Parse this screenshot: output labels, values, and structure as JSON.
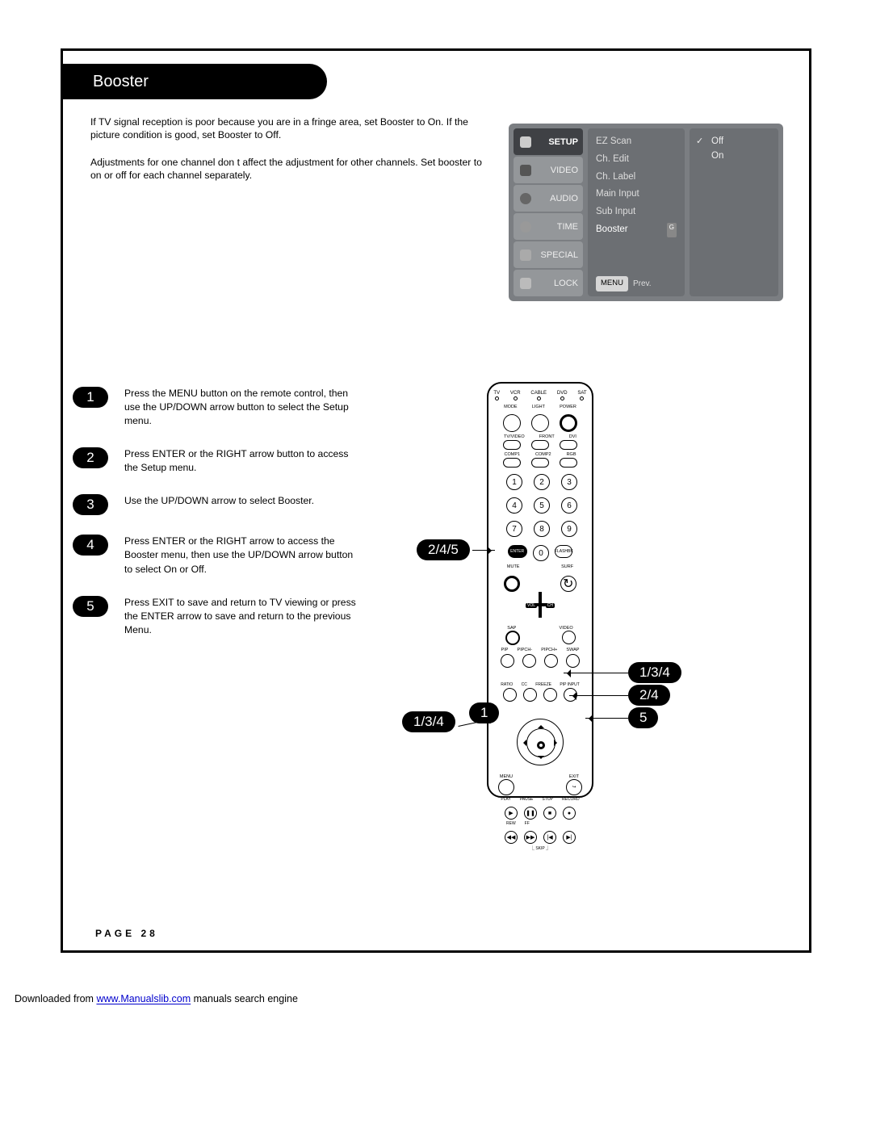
{
  "title": "Booster",
  "intro_p1": "If TV signal reception is poor because you are in a fringe area, set Booster to On. If the picture condition is good, set Booster to Off.",
  "intro_p2": "Adjustments for one channel don t affect the adjustment for other channels. Set booster to on or off for each channel separately.",
  "menu": {
    "tabs": {
      "setup": "SETUP",
      "video": "VIDEO",
      "audio": "AUDIO",
      "time": "TIME",
      "special": "SPECIAL",
      "lock": "LOCK"
    },
    "items": {
      "ezscan": "EZ Scan",
      "chedit": "Ch. Edit",
      "chlabel": "Ch. Label",
      "maininput": "Main Input",
      "subinput": "Sub Input",
      "booster": "Booster"
    },
    "g": "G",
    "menu_btn": "MENU",
    "prev": "Prev.",
    "opt_off": "Off",
    "opt_on": "On",
    "check": "✓"
  },
  "steps": {
    "n1": "1",
    "t1": "Press the MENU button on the remote control, then use the UP/DOWN arrow button to select the Setup menu.",
    "n2": "2",
    "t2": "Press ENTER or the RIGHT arrow button to access the Setup menu.",
    "n3": "3",
    "t3": "Use the UP/DOWN arrow to select Booster.",
    "n4": "4",
    "t4": "Press ENTER or the RIGHT arrow to access the Booster menu, then use the UP/DOWN arrow button to select On or Off.",
    "n5": "5",
    "t5": "Press EXIT to save and return to TV viewing or press the ENTER arrow to save and return to the previous Menu."
  },
  "remote": {
    "top": {
      "tv": "TV",
      "vcr": "VCR",
      "cable": "CABLE",
      "dvd": "DVD",
      "sat": "SAT"
    },
    "row1": {
      "mode": "MODE",
      "light": "LIGHT",
      "power": "POWER"
    },
    "row2": {
      "tvvideo": "TV/VIDEO",
      "front": "FRONT",
      "dvi": "DVI"
    },
    "row3": {
      "comp1": "COMP1",
      "comp2": "COMP2",
      "rgb": "RGB"
    },
    "nums": {
      "n1": "1",
      "n2": "2",
      "n3": "3",
      "n4": "4",
      "n5": "5",
      "n6": "6",
      "n7": "7",
      "n8": "8",
      "n9": "9",
      "n0": "0"
    },
    "enter": "ENTER",
    "flash": "FLASHBK",
    "mute": "MUTE",
    "surf": "SURF",
    "sap": "SAP",
    "video": "VIDEO",
    "vol": "VOL",
    "ch": "CH",
    "pip": "PIP",
    "pipchm": "PIPCH-",
    "pipchp": "PIPCH+",
    "swap": "SWAP",
    "ratio": "RATIO",
    "cc": "CC",
    "freeze": "FREEZE",
    "pipinput": "PIP INPUT",
    "menu": "MENU",
    "exit": "EXIT",
    "play": "PLAY",
    "pause": "PAUSE",
    "stop": "STOP",
    "record": "RECORD",
    "rew": "REW",
    "ff": "FF",
    "skip": "SKIP"
  },
  "callouts": {
    "c245": "2/4/5",
    "c134_l": "1/3/4",
    "c1": "1",
    "c134_r": "1/3/4",
    "c24": "2/4",
    "c5": "5"
  },
  "page_num": "PAGE 28",
  "footer": {
    "pre": "Downloaded from ",
    "link": "www.Manualslib.com",
    "post": " manuals search engine"
  }
}
